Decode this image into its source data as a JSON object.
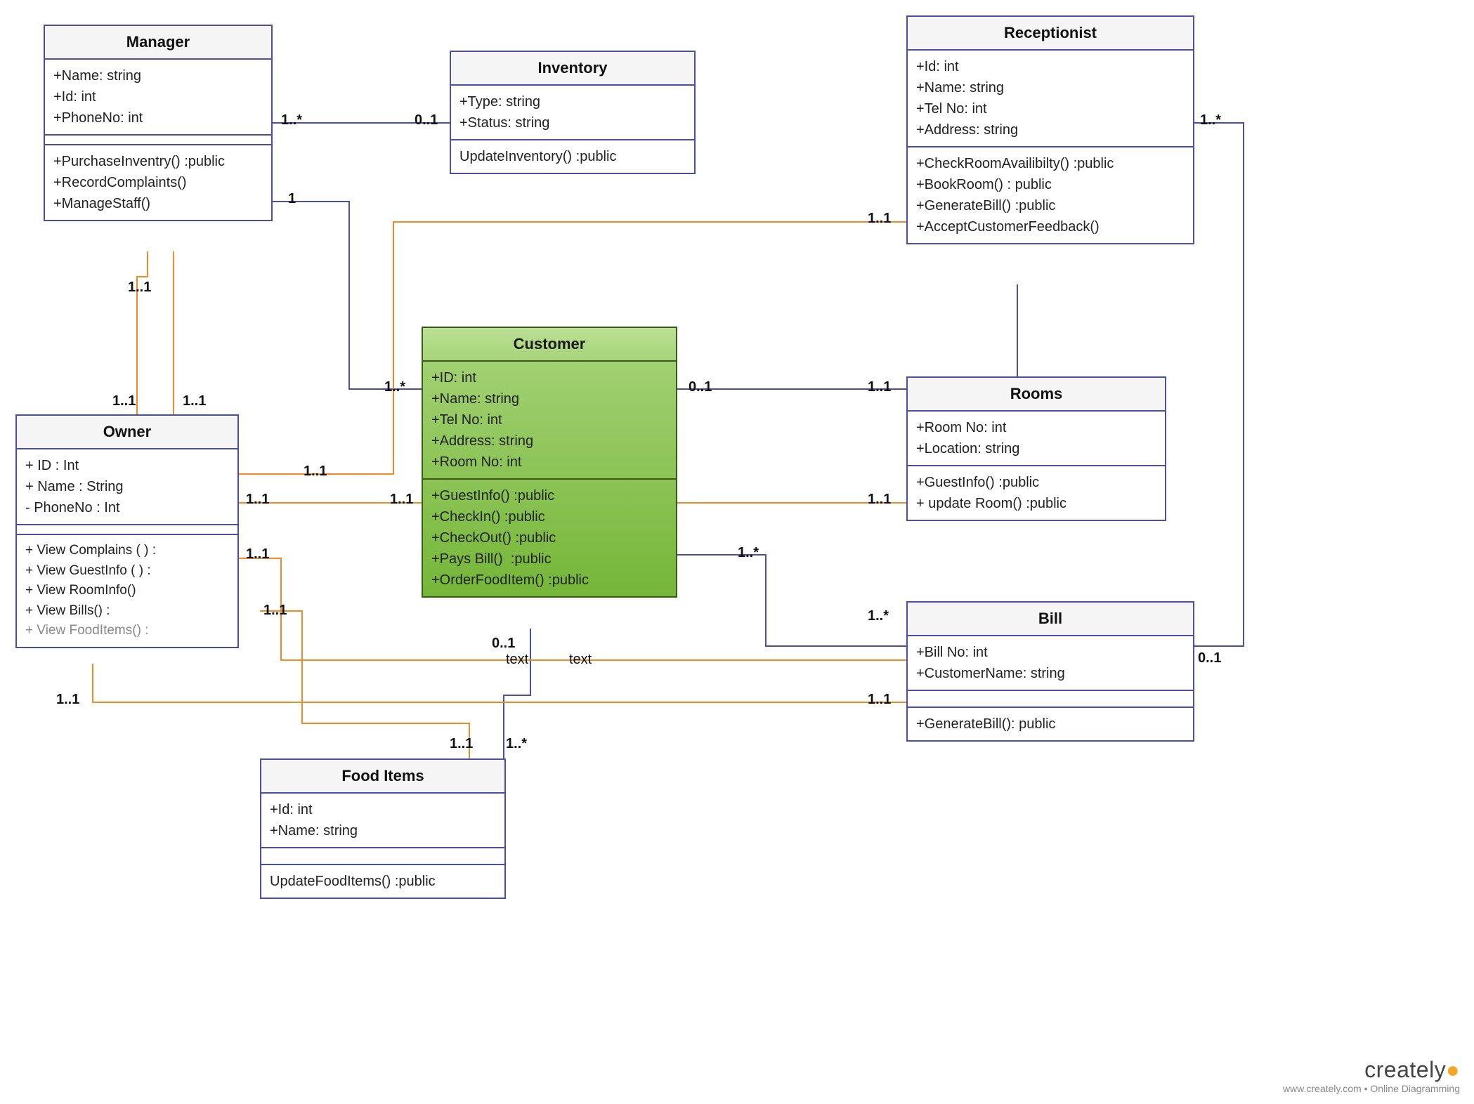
{
  "classes": {
    "manager": {
      "title": "Manager",
      "attrs": [
        "+Name: string",
        "+Id: int",
        "+PhoneNo: int"
      ],
      "ops": [
        "+PurchaseInventry() :public",
        "+RecordComplaints()",
        "+ManageStaff()"
      ]
    },
    "inventory": {
      "title": "Inventory",
      "attrs": [
        "+Type: string",
        "+Status: string"
      ],
      "ops": [
        "UpdateInventory() :public"
      ]
    },
    "receptionist": {
      "title": "Receptionist",
      "attrs": [
        "+Id: int",
        "+Name: string",
        "+Tel No: int",
        "+Address: string"
      ],
      "ops": [
        "+CheckRoomAvailibilty() :public",
        "+BookRoom() : public",
        "+GenerateBill() :public",
        "+AcceptCustomerFeedback()"
      ]
    },
    "owner": {
      "title": "Owner",
      "attrs": [
        "+ ID : Int",
        "+ Name : String",
        "- PhoneNo : Int"
      ],
      "ops": [
        "+ View Complains ( ) :",
        "+ View GuestInfo ( ) :",
        "+ View RoomInfo()",
        "+ View Bills() :",
        "+ View FoodItems() :"
      ]
    },
    "customer": {
      "title": "Customer",
      "attrs": [
        "+ID: int",
        "+Name: string",
        "+Tel No: int",
        "+Address: string",
        "+Room No: int"
      ],
      "ops": [
        "+GuestInfo() :public",
        "+CheckIn() :public",
        "+CheckOut() :public",
        "+Pays Bill()  :public",
        "+OrderFoodItem() :public"
      ]
    },
    "rooms": {
      "title": "Rooms",
      "attrs": [
        "+Room No: int",
        "+Location: string"
      ],
      "ops": [
        "+GuestInfo() :public",
        "+ update Room() :public"
      ]
    },
    "bill": {
      "title": "Bill",
      "attrs": [
        "+Bill No: int",
        "+CustomerName: string"
      ],
      "ops": [
        "+GenerateBill(): public"
      ]
    },
    "fooditems": {
      "title": "Food Items",
      "attrs": [
        "+Id: int",
        "+Name: string"
      ],
      "ops": [
        "UpdateFoodItems() :public"
      ]
    }
  },
  "mults": {
    "m1": "1..*",
    "m2": "0..1",
    "m3": "1..1",
    "m4": "1",
    "m5": "1..*",
    "m6": "1..1",
    "m7": "1..1",
    "m8": "1..1",
    "m9": "1..1",
    "m10": "1..1",
    "m11": "1..1",
    "m12": "1..1",
    "m13": "1..1",
    "m14": "1..1",
    "m15": "0..1",
    "m16": "0..1",
    "m17": "1..1",
    "m18": "1..*",
    "m19": "1..*",
    "m20": "1..1",
    "m21": "1..*",
    "m22": "1..1",
    "m23": "1..*",
    "m24": "1..1",
    "m25": "0..1",
    "m26": "1..*"
  },
  "labels": {
    "t1": "text",
    "t2": "text"
  },
  "logo": {
    "brand": "creately",
    "sub": "www.creately.com • Online Diagramming"
  }
}
